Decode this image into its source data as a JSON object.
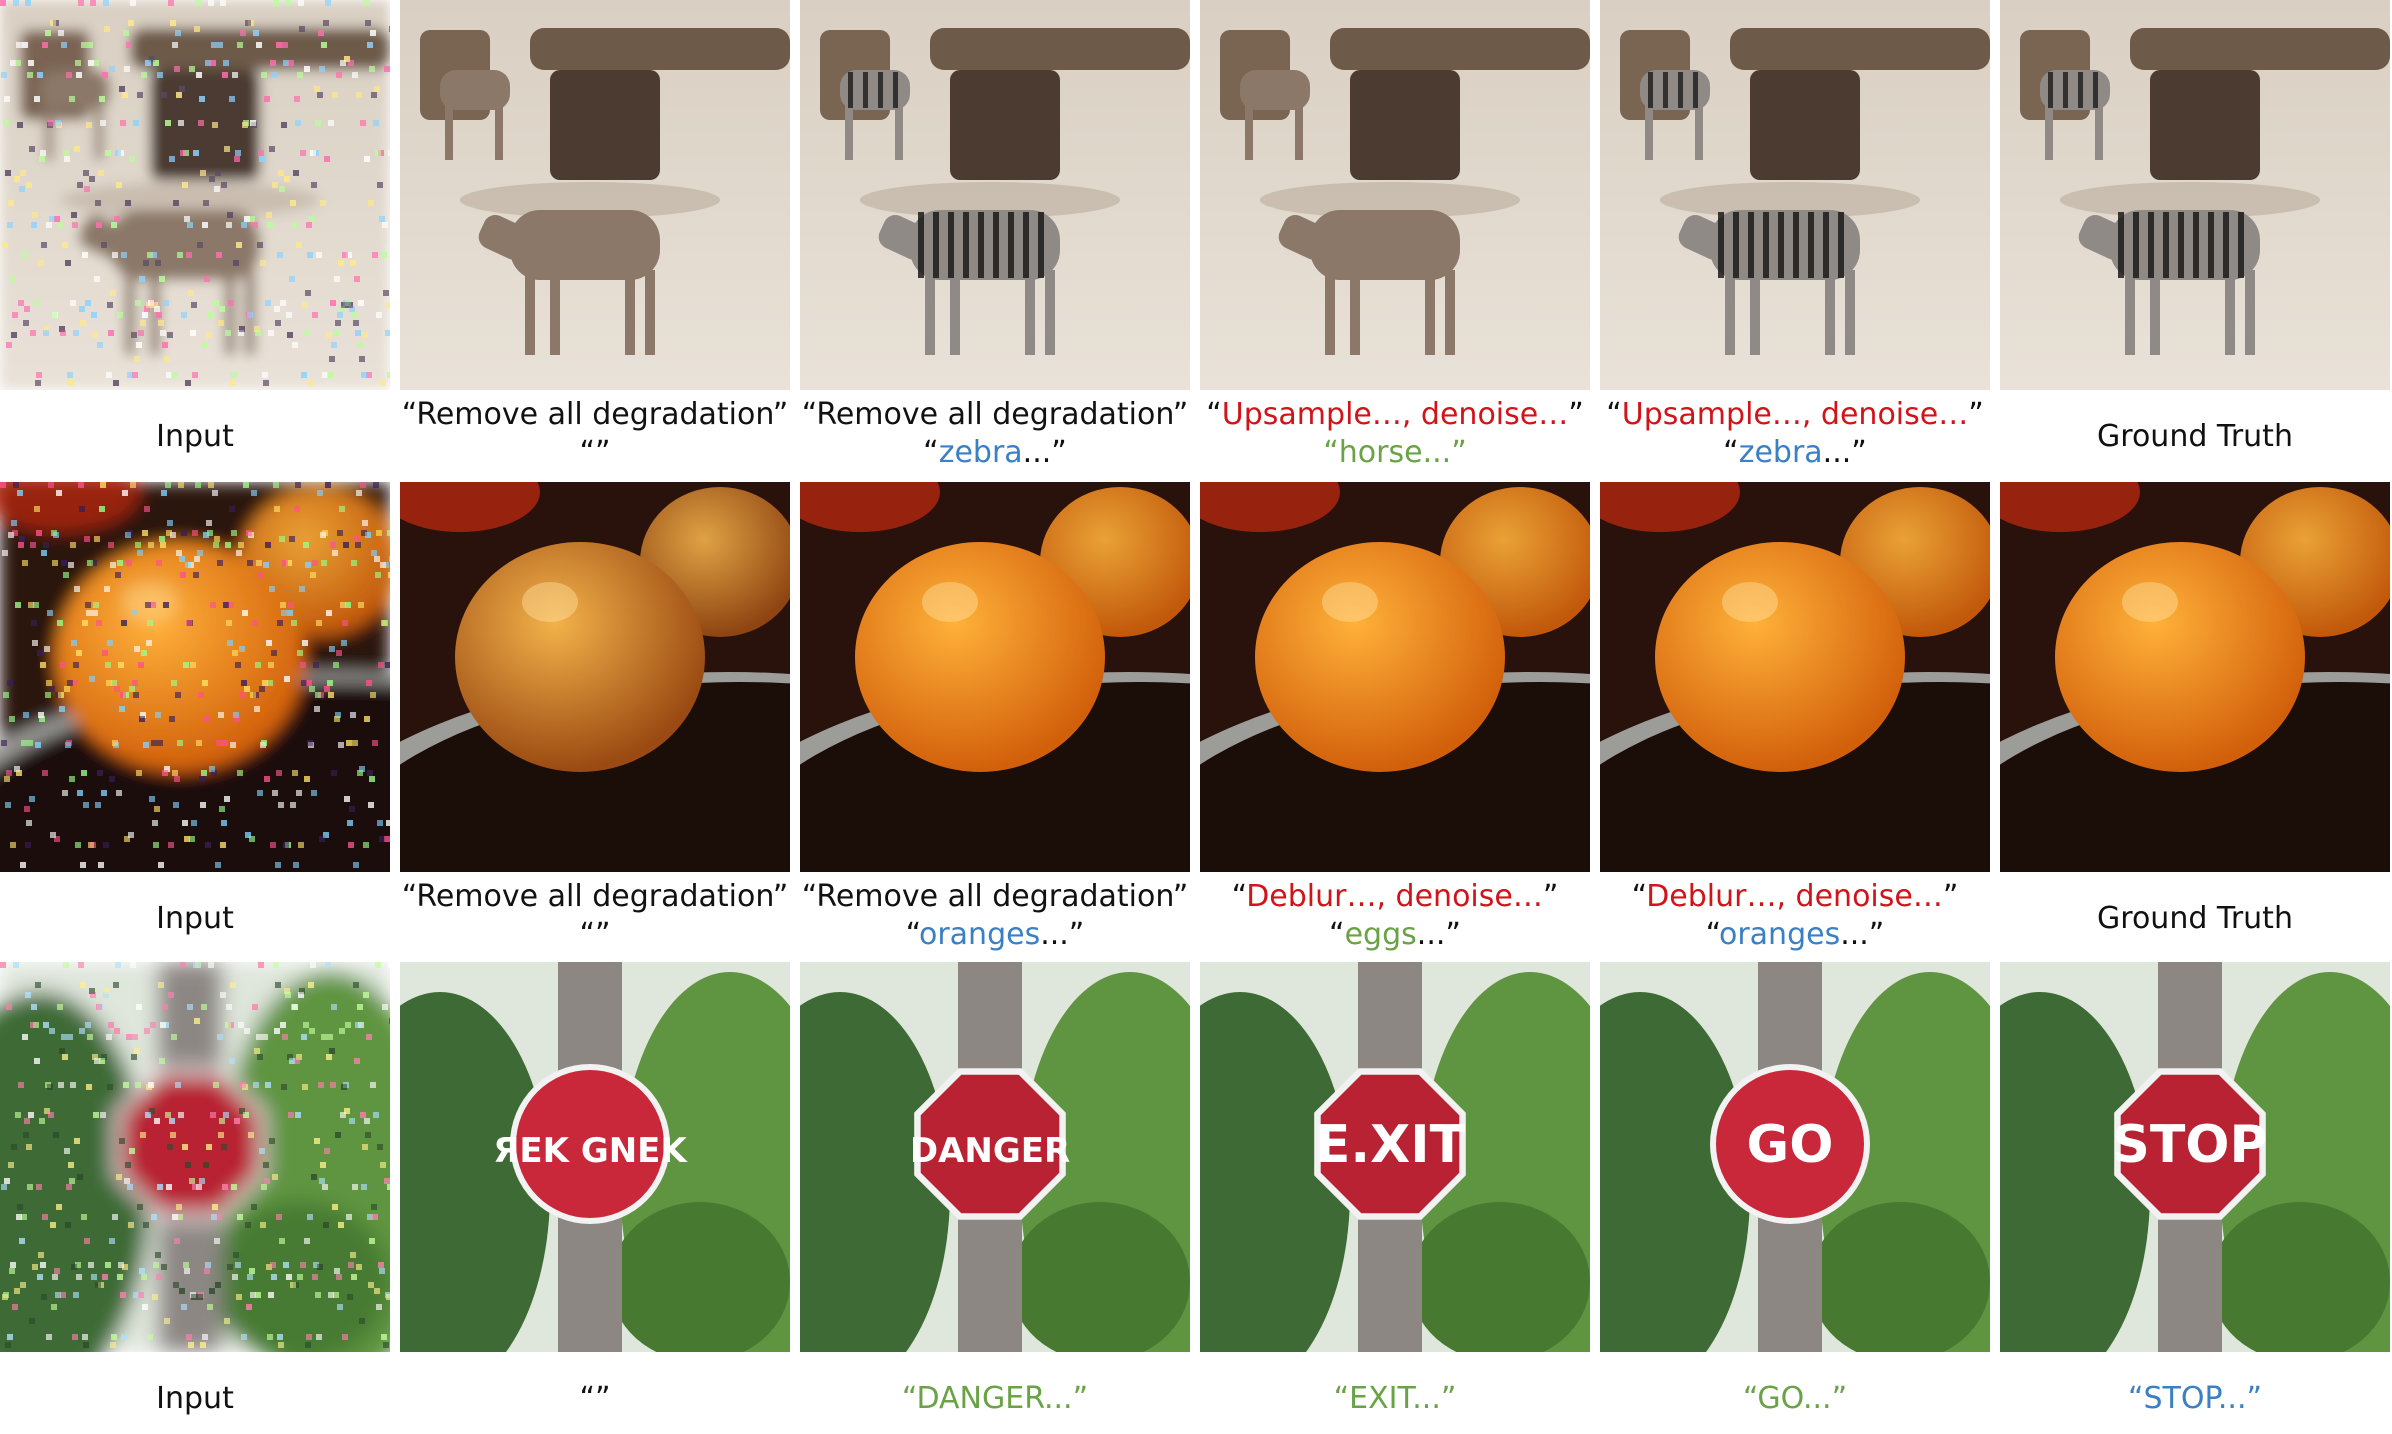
{
  "colors": {
    "red": "#d0141a",
    "blue": "#3b7fc4",
    "green": "#6aa246",
    "black": "#111111"
  },
  "rows": [
    {
      "subject": "zebra",
      "captions": [
        {
          "lines": [
            [
              {
                "t": "Input",
                "c": "blk"
              }
            ]
          ]
        },
        {
          "lines": [
            [
              {
                "t": "“Remove all degradation”",
                "c": "blk"
              }
            ],
            [
              {
                "t": "“”",
                "c": "blk"
              }
            ]
          ]
        },
        {
          "lines": [
            [
              {
                "t": "“Remove all degradation”",
                "c": "blk"
              }
            ],
            [
              {
                "t": "“",
                "c": "blk"
              },
              {
                "t": "zebra",
                "c": "blue"
              },
              {
                "t": "...”",
                "c": "blk"
              }
            ]
          ]
        },
        {
          "lines": [
            [
              {
                "t": "“",
                "c": "blk"
              },
              {
                "t": "Upsample…, denoise…",
                "c": "red"
              },
              {
                "t": "”",
                "c": "blk"
              }
            ],
            [
              {
                "t": "“",
                "c": "green"
              },
              {
                "t": "horse",
                "c": "green"
              },
              {
                "t": "...”",
                "c": "green"
              }
            ]
          ]
        },
        {
          "lines": [
            [
              {
                "t": "“",
                "c": "blk"
              },
              {
                "t": "Upsample…, denoise…",
                "c": "red"
              },
              {
                "t": "”",
                "c": "blk"
              }
            ],
            [
              {
                "t": "“",
                "c": "blk"
              },
              {
                "t": "zebra",
                "c": "blue"
              },
              {
                "t": "...”",
                "c": "blk"
              }
            ]
          ]
        },
        {
          "lines": [
            [
              {
                "t": "Ground Truth",
                "c": "blk"
              }
            ]
          ]
        }
      ]
    },
    {
      "subject": "oranges",
      "captions": [
        {
          "lines": [
            [
              {
                "t": "Input",
                "c": "blk"
              }
            ]
          ]
        },
        {
          "lines": [
            [
              {
                "t": "“Remove all degradation”",
                "c": "blk"
              }
            ],
            [
              {
                "t": "“”",
                "c": "blk"
              }
            ]
          ]
        },
        {
          "lines": [
            [
              {
                "t": "“Remove all degradation”",
                "c": "blk"
              }
            ],
            [
              {
                "t": "“",
                "c": "blk"
              },
              {
                "t": "oranges",
                "c": "blue"
              },
              {
                "t": "...”",
                "c": "blk"
              }
            ]
          ]
        },
        {
          "lines": [
            [
              {
                "t": "“",
                "c": "blk"
              },
              {
                "t": "Deblur…, denoise…",
                "c": "red"
              },
              {
                "t": "”",
                "c": "blk"
              }
            ],
            [
              {
                "t": "“",
                "c": "blk"
              },
              {
                "t": "eggs",
                "c": "green"
              },
              {
                "t": "...”",
                "c": "blk"
              }
            ]
          ]
        },
        {
          "lines": [
            [
              {
                "t": "“",
                "c": "blk"
              },
              {
                "t": "Deblur…, denoise…",
                "c": "red"
              },
              {
                "t": "”",
                "c": "blk"
              }
            ],
            [
              {
                "t": "“",
                "c": "blk"
              },
              {
                "t": "oranges",
                "c": "blue"
              },
              {
                "t": "...”",
                "c": "blk"
              }
            ]
          ]
        },
        {
          "lines": [
            [
              {
                "t": "Ground Truth",
                "c": "blk"
              }
            ]
          ]
        }
      ]
    },
    {
      "subject": "sign",
      "captions": [
        {
          "lines": [
            [
              {
                "t": "Input",
                "c": "blk"
              }
            ]
          ]
        },
        {
          "lines": [
            [
              {
                "t": "“”",
                "c": "blk"
              }
            ]
          ]
        },
        {
          "lines": [
            [
              {
                "t": "“DANGER...”",
                "c": "green"
              }
            ]
          ]
        },
        {
          "lines": [
            [
              {
                "t": "“EXIT...”",
                "c": "green"
              }
            ]
          ]
        },
        {
          "lines": [
            [
              {
                "t": "“GO...”",
                "c": "green"
              }
            ]
          ]
        },
        {
          "lines": [
            [
              {
                "t": "“STOP...”",
                "c": "blue"
              }
            ]
          ]
        }
      ],
      "sign_texts": [
        "",
        "ЯEK GNEK",
        "DANGER",
        "E.XIT",
        "GO",
        "STOP"
      ]
    }
  ]
}
